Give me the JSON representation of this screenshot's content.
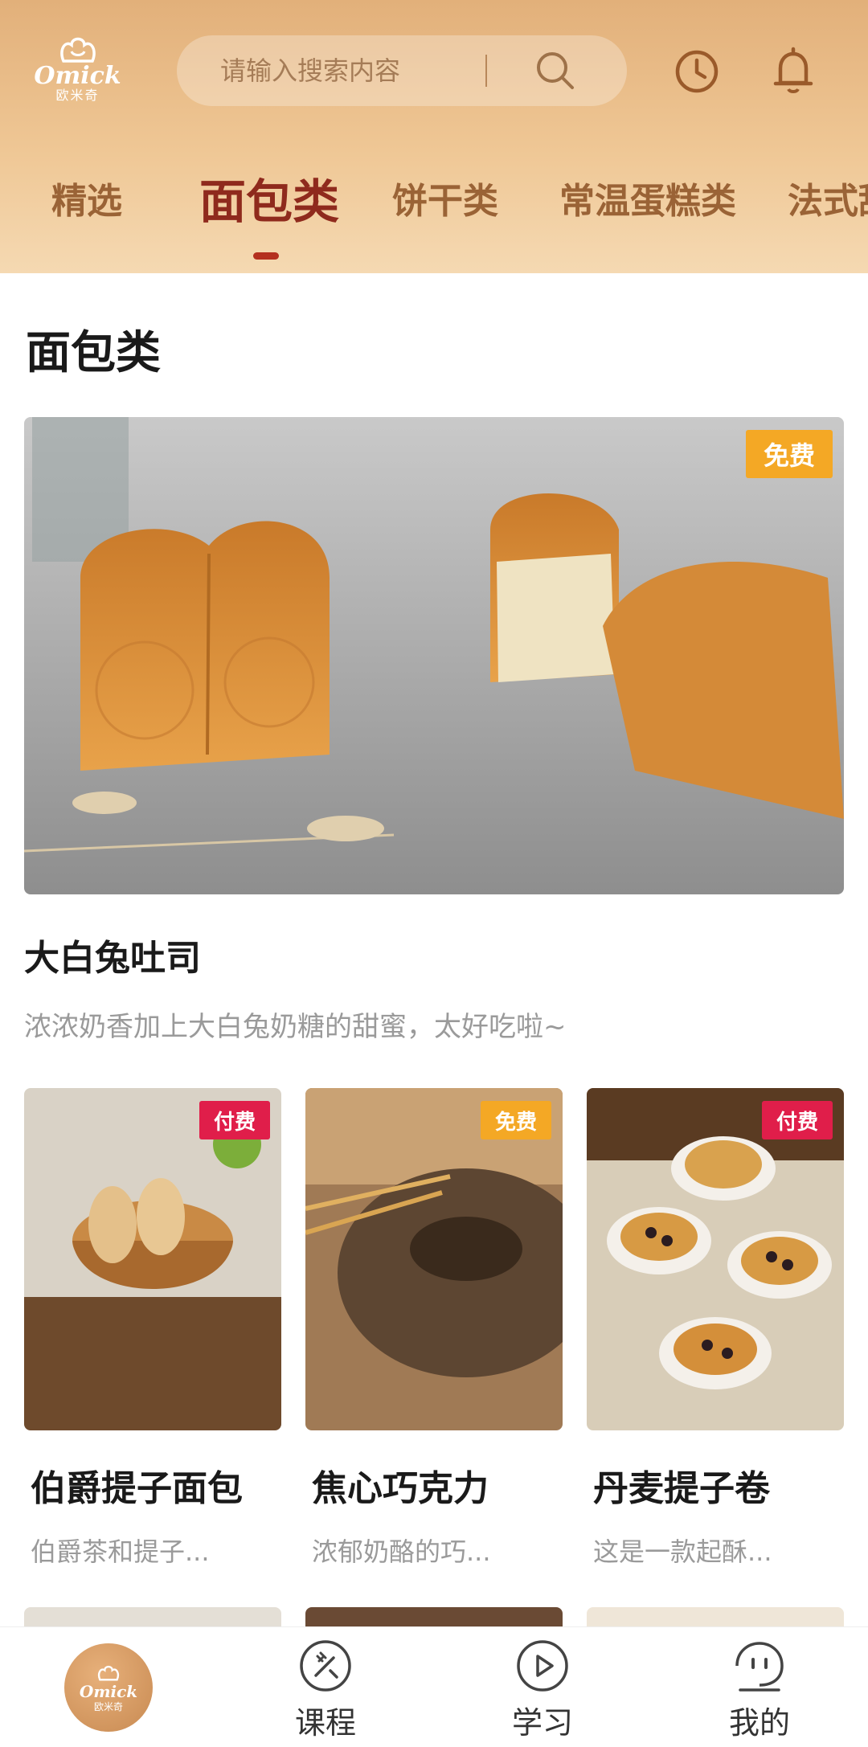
{
  "header": {
    "brand_en": "Omick",
    "brand_cn": "欧米奇",
    "search_placeholder": "请输入搜索内容"
  },
  "tabs": [
    {
      "label": "精选"
    },
    {
      "label": "面包类"
    },
    {
      "label": "饼干类"
    },
    {
      "label": "常温蛋糕类"
    },
    {
      "label": "法式甜"
    }
  ],
  "active_tab": "面包类",
  "section": {
    "title": "面包类"
  },
  "hero": {
    "badge": "免费",
    "title": "大白兔吐司",
    "desc": "浓浓奶香加上大白兔奶糖的甜蜜，太好吃啦~"
  },
  "cards": [
    {
      "badge": "付费",
      "title": "伯爵提子面包",
      "desc": "伯爵茶和提子..."
    },
    {
      "badge": "免费",
      "title": "焦心巧克力",
      "desc": "浓郁奶酪的巧..."
    },
    {
      "badge": "付费",
      "title": "丹麦提子卷",
      "desc": "这是一款起酥..."
    }
  ],
  "bottom_nav": {
    "home": {
      "brand_en": "Omick",
      "brand_cn": "欧米奇"
    },
    "items": [
      {
        "label": "课程",
        "icon": "course-icon"
      },
      {
        "label": "学习",
        "icon": "play-icon"
      },
      {
        "label": "我的",
        "icon": "profile-icon"
      }
    ]
  },
  "colors": {
    "header_top": "#e2b07a",
    "active_tab": "#8f2a1d",
    "tab": "#9a6336",
    "free_badge": "#f4a825",
    "paid_badge": "#e01e4a"
  }
}
